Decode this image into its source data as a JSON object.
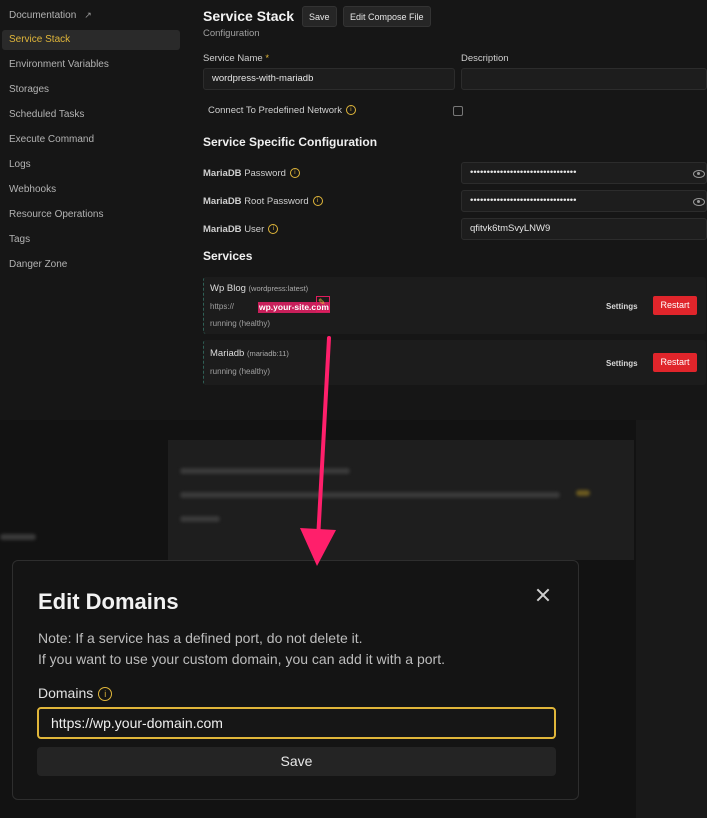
{
  "sidebar": {
    "items": [
      {
        "label": "Documentation",
        "ext": "↗"
      },
      {
        "label": "Service Stack"
      },
      {
        "label": "Environment Variables"
      },
      {
        "label": "Storages"
      },
      {
        "label": "Scheduled Tasks"
      },
      {
        "label": "Execute Command"
      },
      {
        "label": "Logs"
      },
      {
        "label": "Webhooks"
      },
      {
        "label": "Resource Operations"
      },
      {
        "label": "Tags"
      },
      {
        "label": "Danger Zone"
      }
    ]
  },
  "header": {
    "title": "Service Stack",
    "save_label": "Save",
    "edit_compose_label": "Edit Compose File",
    "subtitle": "Configuration"
  },
  "form": {
    "service_name_label": "Service Name",
    "required_mark": "*",
    "service_name_value": "wordpress-with-mariadb",
    "description_label": "Description",
    "network_label": "Connect To Predefined Network"
  },
  "specific": {
    "title": "Service Specific Configuration",
    "fields": [
      {
        "prefix": "MariaDB",
        "label": "Password",
        "value": "••••••••••••••••••••••••••••••••"
      },
      {
        "prefix": "MariaDB",
        "label": "Root Password",
        "value": "••••••••••••••••••••••••••••••••"
      },
      {
        "prefix": "MariaDB",
        "label": "User",
        "value": "qfitvk6tmSvyLNW9"
      }
    ]
  },
  "services": {
    "title": "Services",
    "items": [
      {
        "name": "Wp Blog",
        "image": "(wordpress:latest)",
        "url_prefix": "https://",
        "domain": "wp.your-site.com",
        "status": "running (healthy)",
        "settings": "Settings",
        "restart": "Restart"
      },
      {
        "name": "Mariadb",
        "image": "(mariadb:11)",
        "status": "running (healthy)",
        "settings": "Settings",
        "restart": "Restart"
      }
    ]
  },
  "modal": {
    "title": "Edit Domains",
    "note_line1": "Note: If a service has a defined port, do not delete it.",
    "note_line2": "If you want to use your custom domain, you can add it with a port.",
    "domains_label": "Domains",
    "domains_value": "https://wp.your-domain.com",
    "save_label": "Save"
  },
  "colors": {
    "accent": "#e0b63a",
    "restart": "#e0252b",
    "arrow": "#ff1f6b"
  }
}
